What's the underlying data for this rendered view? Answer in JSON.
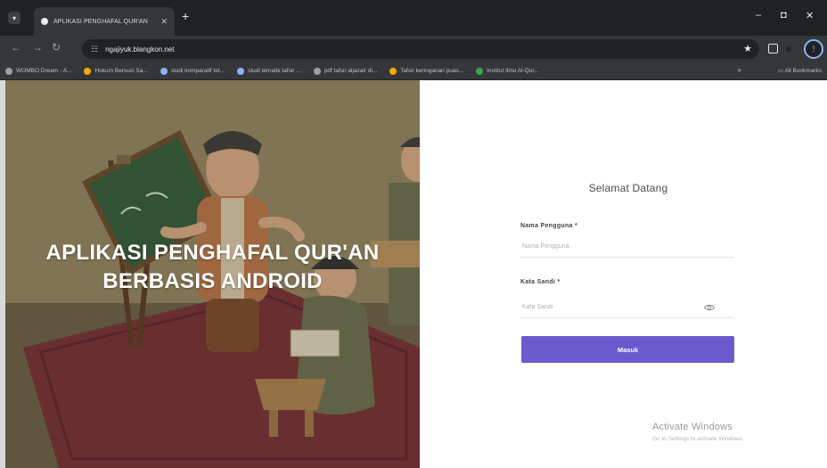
{
  "browser": {
    "tab_title": "APLIKASI PENGHAFAL QUR'AN",
    "new_tab_symbol": "+",
    "url": "ngajiyuk.blangkon.net",
    "bookmarks": [
      {
        "label": "WOMBO Dream - A...",
        "color": "#9aa0a6"
      },
      {
        "label": "Hukum Bersuci Sa...",
        "color": "#f9ab00"
      },
      {
        "label": "studi komparatif tet...",
        "color": "#8ab4f8"
      },
      {
        "label": "studi tematik tafsir ...",
        "color": "#8ab4f8"
      },
      {
        "label": "pdf tafsir aljazair di...",
        "color": "#9aa0a6"
      },
      {
        "label": "Tafsir keringanan puas...",
        "color": "#f9ab00"
      },
      {
        "label": "Institut Ilmu Al-Qur...",
        "color": "#34a853"
      }
    ],
    "all_bookmarks": "All Bookmarks",
    "more_symbol": "»",
    "profile_initial": "!"
  },
  "hero": {
    "title_line1": "APLIKASI PENGHAFAL QUR'AN",
    "title_line2": "BERBASIS ANDROID"
  },
  "login": {
    "welcome": "Selamat Datang",
    "username_label": "Nama Pengguna *",
    "username_placeholder": "Nama Pengguna",
    "password_label": "Kata Sandi *",
    "password_placeholder": "Kata Sandi",
    "submit_label": "Masuk"
  },
  "watermark": {
    "line1": "Activate Windows",
    "line2": "Go to Settings to activate Windows."
  },
  "colors": {
    "accent": "#6a5acd",
    "chrome_dark": "#202124",
    "chrome_mid": "#35363a"
  }
}
